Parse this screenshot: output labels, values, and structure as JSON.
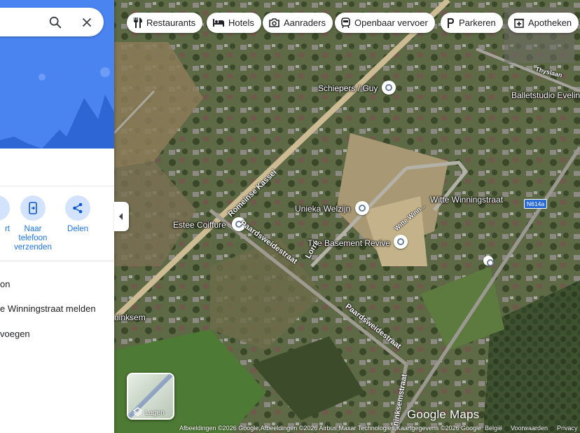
{
  "panel": {
    "actions": [
      {
        "label": "rt",
        "icon": "route-icon"
      },
      {
        "label": "Naar\ntelefoon\nverzenden",
        "icon": "send-to-phone-icon"
      },
      {
        "label": "Delen",
        "icon": "share-icon"
      }
    ],
    "list": [
      {
        "label": "on"
      },
      {
        "label": "e Winningstraat melden"
      },
      {
        "label": "voegen"
      }
    ]
  },
  "chips": [
    {
      "label": "Restaurants",
      "icon": "restaurant-icon"
    },
    {
      "label": "Hotels",
      "icon": "hotel-icon"
    },
    {
      "label": "Aanraders",
      "icon": "camera-icon"
    },
    {
      "label": "Openbaar vervoer",
      "icon": "transit-icon"
    },
    {
      "label": "Parkeren",
      "icon": "parking-icon"
    },
    {
      "label": "Apotheken",
      "icon": "pharmacy-icon"
    }
  ],
  "map": {
    "places": [
      {
        "label": "Schiepers / Guy"
      },
      {
        "label": "Balletstudio Eveline"
      },
      {
        "label": "Unieka Welzijn"
      },
      {
        "label": "Estee Coiffure"
      },
      {
        "label": "The Basement Revive"
      },
      {
        "label": "Witte Winningstraat"
      },
      {
        "label": "ninksem"
      }
    ],
    "roads": [
      {
        "label": "Romeinse Kassei"
      },
      {
        "label": "Paardsweidestraat"
      },
      {
        "label": "Paardsweidestraat"
      },
      {
        "label": "Lorre"
      },
      {
        "label": "Witte Winn..."
      },
      {
        "label": "ninksemstraat"
      },
      {
        "label": "Thyslaan"
      }
    ],
    "route_badge": "N614a",
    "layers_label": "Lagen",
    "logo": "Google Maps",
    "footer": {
      "attribution": "Afbeeldingen ©2026 Google,Afbeeldingen ©2026 Airbus,Maxar Technologies,Kaartgegevens ©2026 Google",
      "country": "België",
      "terms": "Voorwaarden",
      "privacy": "Privacy"
    }
  }
}
